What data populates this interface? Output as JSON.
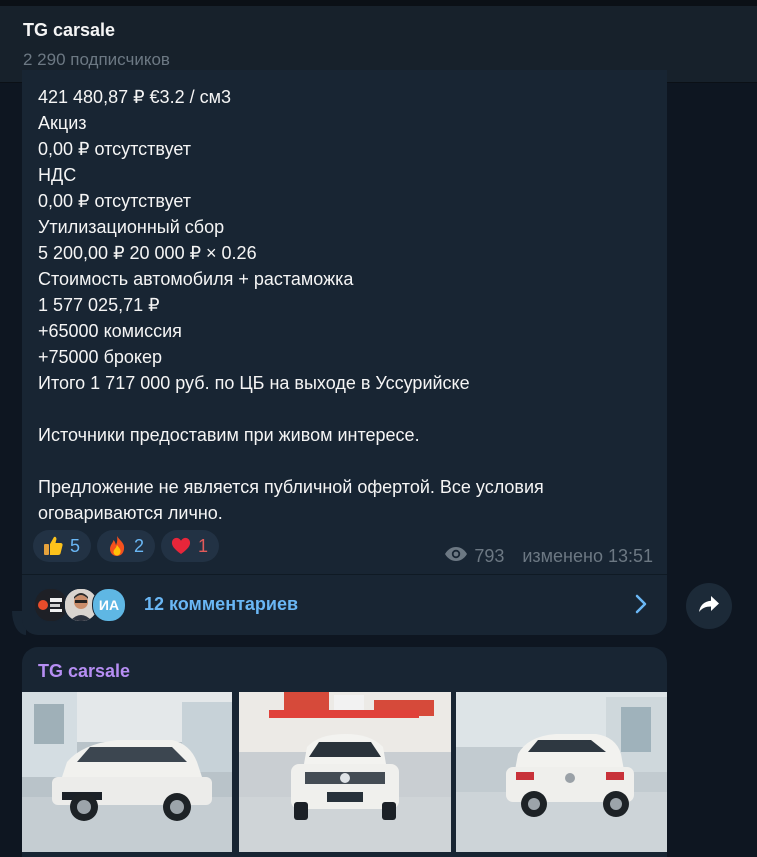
{
  "header": {
    "channel_name": "TG carsale",
    "subscribers": "2 290 подписчиков"
  },
  "message": {
    "lines": [
      "421 480,87 ₽ €3.2 / см3",
      "Акциз",
      "0,00 ₽ отсутствует",
      "НДС",
      "0,00 ₽ отсутствует",
      "Утилизационный сбор",
      "5 200,00 ₽ 20 000 ₽ × 0.26",
      "Стоимость автомобиля + растаможка",
      "1 577 025,71 ₽",
      "+65000 комиссия",
      "+75000 брокер",
      "Итого 1 717 000 руб. по ЦБ на выходе в Уссурийске",
      "",
      "Источники предоставим при живом интересе.",
      "",
      "Предложение не является публичной офертой. Все условия",
      "оговариваются лично."
    ],
    "reactions": [
      {
        "emoji": "thumbs-up-icon",
        "count": "5"
      },
      {
        "emoji": "fire-icon",
        "count": "2"
      },
      {
        "emoji": "heart-icon",
        "count": "1"
      }
    ],
    "views": "793",
    "edited": "изменено 13:51",
    "comments": {
      "label": "12 комментариев",
      "avatar_initials": "ИА"
    }
  },
  "next_message": {
    "sender": "TG carsale",
    "photos": [
      "car-photo-side",
      "car-photo-front",
      "car-photo-rear"
    ]
  },
  "colors": {
    "background": "#0e1621",
    "bubble": "#182533",
    "accent": "#6ab7f5",
    "sender": "#b68ef3",
    "muted": "#6c7883"
  }
}
